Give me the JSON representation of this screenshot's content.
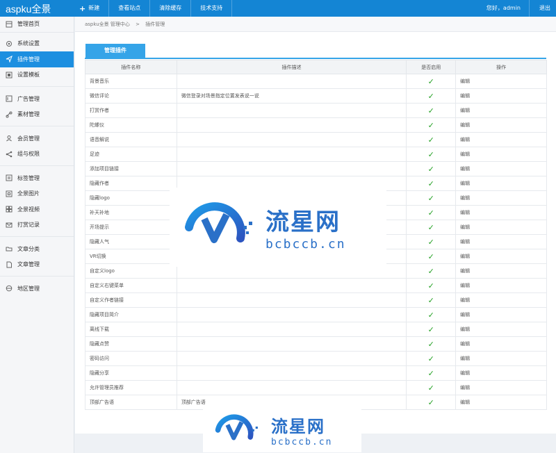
{
  "app": {
    "logo": "aspku全景"
  },
  "topnav": {
    "items": [
      "新建",
      "查看站点",
      "清除缓存",
      "技术支持"
    ],
    "greeting": "您好，admin",
    "logout": "退出"
  },
  "sidebar": {
    "items": [
      {
        "label": "管理首页",
        "icon": "home-icon"
      },
      {
        "label": "系统设置",
        "icon": "gear-icon"
      },
      {
        "label": "插件管理",
        "icon": "send-icon",
        "active": true
      },
      {
        "label": "设置模板",
        "icon": "template-icon"
      },
      {
        "label": "广告管理",
        "icon": "ad-icon"
      },
      {
        "label": "素材管理",
        "icon": "link-icon"
      },
      {
        "label": "会员管理",
        "icon": "users-icon"
      },
      {
        "label": "组与权限",
        "icon": "share-icon"
      },
      {
        "label": "标签管理",
        "icon": "tag-icon"
      },
      {
        "label": "全景图片",
        "icon": "grid-icon"
      },
      {
        "label": "全景视频",
        "icon": "video-icon"
      },
      {
        "label": "打赏记录",
        "icon": "mail-icon"
      },
      {
        "label": "文章分类",
        "icon": "folder-icon"
      },
      {
        "label": "文章管理",
        "icon": "file-icon"
      },
      {
        "label": "地区管理",
        "icon": "globe-icon"
      }
    ]
  },
  "breadcrumb": {
    "home": "aspku全景 管理中心",
    "sep": ">",
    "current": "插件管理"
  },
  "tab": {
    "label": "管理插件"
  },
  "table": {
    "headers": [
      "插件名称",
      "插件描述",
      "是否启用",
      "操作"
    ],
    "rows": [
      {
        "name": "背景音乐",
        "desc": "",
        "enabled": "✓",
        "action": "编辑"
      },
      {
        "name": "微信评论",
        "desc": "微信登录对场景指定位置发表说一说",
        "enabled": "✓",
        "action": "编辑"
      },
      {
        "name": "打赏作者",
        "desc": "",
        "enabled": "✓",
        "action": "编辑"
      },
      {
        "name": "陀螺仪",
        "desc": "",
        "enabled": "✓",
        "action": "编辑"
      },
      {
        "name": "语音解说",
        "desc": "",
        "enabled": "✓",
        "action": "编辑"
      },
      {
        "name": "足迹",
        "desc": "",
        "enabled": "✓",
        "action": "编辑"
      },
      {
        "name": "添加项目链接",
        "desc": "",
        "enabled": "✓",
        "action": "编辑"
      },
      {
        "name": "隐藏作者",
        "desc": "",
        "enabled": "✓",
        "action": "编辑"
      },
      {
        "name": "隐藏logo",
        "desc": "",
        "enabled": "✓",
        "action": "编辑"
      },
      {
        "name": "补天补地",
        "desc": "",
        "enabled": "✓",
        "action": "编辑"
      },
      {
        "name": "开场提示",
        "desc": "",
        "enabled": "✓",
        "action": "编辑"
      },
      {
        "name": "隐藏人气",
        "desc": "",
        "enabled": "✓",
        "action": "编辑"
      },
      {
        "name": "VR切换",
        "desc": "",
        "enabled": "✓",
        "action": "编辑"
      },
      {
        "name": "自定义logo",
        "desc": "",
        "enabled": "✓",
        "action": "编辑"
      },
      {
        "name": "自定义右键菜单",
        "desc": "",
        "enabled": "✓",
        "action": "编辑"
      },
      {
        "name": "自定义作者链接",
        "desc": "",
        "enabled": "✓",
        "action": "编辑"
      },
      {
        "name": "隐藏项目简介",
        "desc": "",
        "enabled": "✓",
        "action": "编辑"
      },
      {
        "name": "离线下载",
        "desc": "",
        "enabled": "✓",
        "action": "编辑"
      },
      {
        "name": "隐藏点赞",
        "desc": "",
        "enabled": "✓",
        "action": "编辑"
      },
      {
        "name": "密码访问",
        "desc": "",
        "enabled": "✓",
        "action": "编辑"
      },
      {
        "name": "隐藏分享",
        "desc": "",
        "enabled": "✓",
        "action": "编辑"
      },
      {
        "name": "允许管理员推荐",
        "desc": "",
        "enabled": "✓",
        "action": "编辑"
      },
      {
        "name": "顶部广告语",
        "desc": "顶部广告语",
        "enabled": "✓",
        "action": "编辑"
      }
    ]
  },
  "watermark": {
    "cn": "流星网",
    "en": "bcbccb.cn"
  }
}
